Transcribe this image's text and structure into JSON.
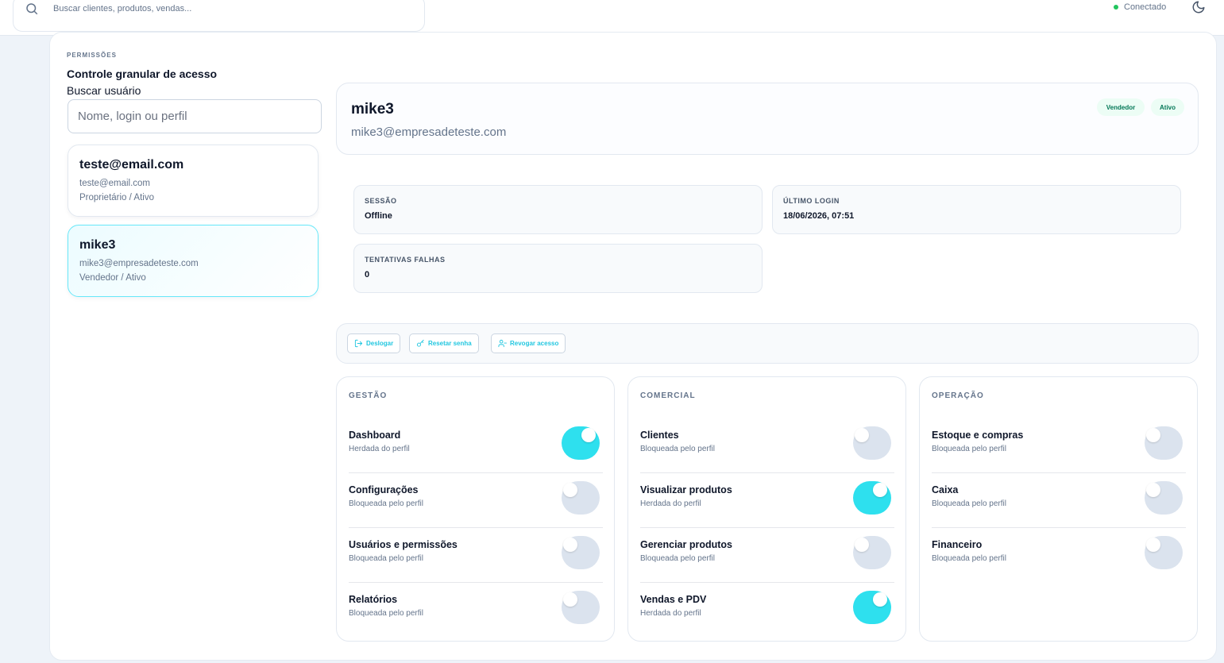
{
  "topbar": {
    "search_placeholder": "Buscar clientes, produtos, vendas...",
    "status_label": "Conectado",
    "status_color": "#22c55e"
  },
  "sidebar": {
    "eyebrow": "PERMISSÕES",
    "title": "Controle granular de acesso",
    "search_label": "Buscar usuário",
    "search_placeholder": "Nome, login ou perfil",
    "users": [
      {
        "name": "teste@email.com",
        "email": "teste@email.com",
        "role": "Proprietário / Ativo"
      },
      {
        "name": "mike3",
        "email": "mike3@empresadeteste.com",
        "role": "Vendedor / Ativo"
      }
    ]
  },
  "detail": {
    "name": "mike3",
    "email": "mike3@empresadeteste.com",
    "badges": [
      "Vendedor",
      "Ativo"
    ],
    "stats": [
      {
        "label": "SESSÃO",
        "value": "Offline"
      },
      {
        "label": "ÚLTIMO LOGIN",
        "value": "18/06/2026, 07:51"
      },
      {
        "label": "TENTATIVAS FALHAS",
        "value": "0"
      }
    ],
    "actions": [
      "Deslogar",
      "Resetar senha",
      "Revogar acesso"
    ]
  },
  "accent_color": "#2ee0ee",
  "groups": [
    {
      "title": "GESTÃO",
      "items": [
        {
          "name": "Dashboard",
          "status": "Herdada do perfil",
          "enabled": true
        },
        {
          "name": "Configurações",
          "status": "Bloqueada pelo perfil",
          "enabled": false
        },
        {
          "name": "Usuários e permissões",
          "status": "Bloqueada pelo perfil",
          "enabled": false
        },
        {
          "name": "Relatórios",
          "status": "Bloqueada pelo perfil",
          "enabled": false
        }
      ]
    },
    {
      "title": "COMERCIAL",
      "items": [
        {
          "name": "Clientes",
          "status": "Bloqueada pelo perfil",
          "enabled": false
        },
        {
          "name": "Visualizar produtos",
          "status": "Herdada do perfil",
          "enabled": true
        },
        {
          "name": "Gerenciar produtos",
          "status": "Bloqueada pelo perfil",
          "enabled": false
        },
        {
          "name": "Vendas e PDV",
          "status": "Herdada do perfil",
          "enabled": true
        }
      ]
    },
    {
      "title": "OPERAÇÃO",
      "items": [
        {
          "name": "Estoque e compras",
          "status": "Bloqueada pelo perfil",
          "enabled": false
        },
        {
          "name": "Caixa",
          "status": "Bloqueada pelo perfil",
          "enabled": false
        },
        {
          "name": "Financeiro",
          "status": "Bloqueada pelo perfil",
          "enabled": false
        }
      ]
    }
  ]
}
